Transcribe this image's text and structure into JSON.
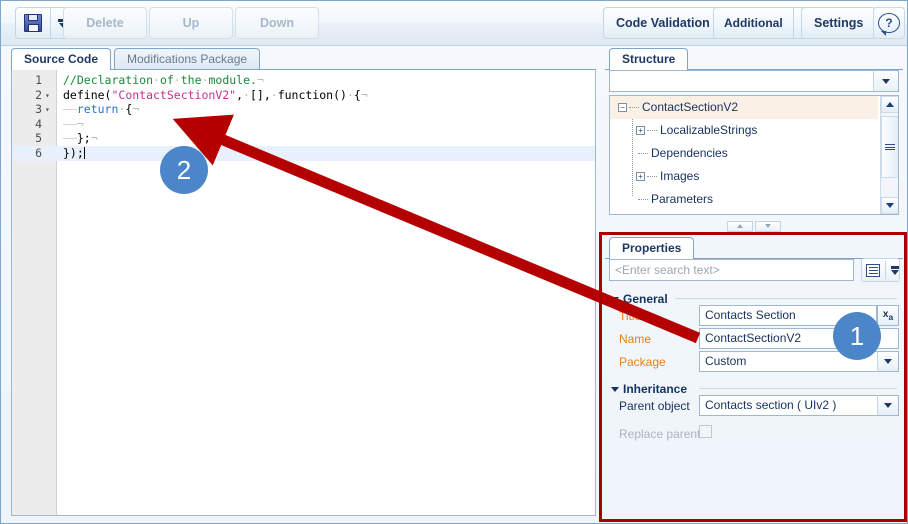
{
  "toolbar": {
    "save_icon": "floppy-save-icon",
    "save_dropdown_icon": "chevron-down-icon",
    "delete_label": "Delete",
    "up_label": "Up",
    "down_label": "Down",
    "code_validation_label": "Code Validation",
    "additional_label": "Additional",
    "additional_dropdown_icon": "chevron-down-icon",
    "settings_label": "Settings",
    "help_icon": "help-question-icon"
  },
  "editor": {
    "tabs": [
      {
        "label": "Source Code",
        "active": true
      },
      {
        "label": "Modifications Package",
        "active": false
      }
    ],
    "lines": [
      {
        "num": "1",
        "fold": "",
        "current": false,
        "tokens": [
          {
            "t": "comment",
            "v": "//Declaration"
          },
          {
            "t": "ws",
            "v": "·"
          },
          {
            "t": "comment",
            "v": "of"
          },
          {
            "t": "ws",
            "v": "·"
          },
          {
            "t": "comment",
            "v": "the"
          },
          {
            "t": "ws",
            "v": "·"
          },
          {
            "t": "comment",
            "v": "module."
          },
          {
            "t": "eol",
            "v": "¬"
          }
        ]
      },
      {
        "num": "2",
        "fold": "▾",
        "current": false,
        "tokens": [
          {
            "t": "plain",
            "v": "define("
          },
          {
            "t": "string",
            "v": "\"ContactSectionV2\""
          },
          {
            "t": "plain",
            "v": ","
          },
          {
            "t": "ws",
            "v": "·"
          },
          {
            "t": "plain",
            "v": "[],"
          },
          {
            "t": "ws",
            "v": "·"
          },
          {
            "t": "plain",
            "v": "function()"
          },
          {
            "t": "ws",
            "v": "·"
          },
          {
            "t": "plain",
            "v": "{"
          },
          {
            "t": "eol",
            "v": "¬"
          }
        ]
      },
      {
        "num": "3",
        "fold": "▾",
        "current": false,
        "tokens": [
          {
            "t": "indent",
            "v": "——"
          },
          {
            "t": "keyword",
            "v": "return"
          },
          {
            "t": "ws",
            "v": "·"
          },
          {
            "t": "plain",
            "v": "{"
          },
          {
            "t": "eol",
            "v": "¬"
          }
        ]
      },
      {
        "num": "4",
        "fold": "",
        "current": false,
        "tokens": [
          {
            "t": "indent",
            "v": "——"
          },
          {
            "t": "eol",
            "v": "¬"
          }
        ]
      },
      {
        "num": "5",
        "fold": "",
        "current": false,
        "tokens": [
          {
            "t": "indent",
            "v": "——"
          },
          {
            "t": "plain",
            "v": "};"
          },
          {
            "t": "eol",
            "v": "¬"
          }
        ]
      },
      {
        "num": "6",
        "fold": "",
        "current": true,
        "tokens": [
          {
            "t": "plain",
            "v": "});"
          },
          {
            "t": "caret",
            "v": ""
          }
        ]
      }
    ]
  },
  "structure": {
    "tab_label": "Structure",
    "combo_value": "",
    "combo_icon": "chevron-down-icon",
    "tree": [
      {
        "label": "ContactSectionV2",
        "depth": 0,
        "expander": "minus",
        "selected": true
      },
      {
        "label": "LocalizableStrings",
        "depth": 1,
        "expander": "plus",
        "selected": false
      },
      {
        "label": "Dependencies",
        "depth": 1,
        "expander": "none",
        "selected": false
      },
      {
        "label": "Images",
        "depth": 1,
        "expander": "plus",
        "selected": false
      },
      {
        "label": "Parameters",
        "depth": 1,
        "expander": "none",
        "selected": false
      }
    ],
    "scroll_up_icon": "triangle-up-icon",
    "scroll_down_icon": "triangle-down-icon",
    "scroll_thumb_icon": "grip-icon"
  },
  "splitter": {
    "collapse_up_icon": "triangle-up-icon",
    "collapse_down_icon": "triangle-down-icon"
  },
  "properties": {
    "tab_label": "Properties",
    "search_placeholder": "<Enter search text>",
    "search_value": "",
    "search_button_icon": "property-list-icon",
    "search_button_dropdown_icon": "chevron-down-icon",
    "sections": [
      {
        "title": "General"
      },
      {
        "title": "Inheritance"
      }
    ],
    "fields": {
      "title_label": "Title",
      "title_value": "Contacts Section",
      "title_translate_icon": "translate-xa-icon",
      "name_label": "Name",
      "name_value": "ContactSectionV2",
      "package_label": "Package",
      "package_value": "Custom",
      "package_dropdown_icon": "chevron-down-icon",
      "parent_object_label": "Parent object",
      "parent_object_value": "Contacts section ( UIv2 )",
      "parent_object_dropdown_icon": "chevron-down-icon",
      "replace_parent_label": "Replace parent",
      "replace_parent_checked": false
    }
  },
  "annotations": {
    "badge_one": "1",
    "badge_two": "2",
    "arrow_icon": "red-arrow-icon",
    "highlight_box_icon": "red-highlight-box",
    "accent_color": "#4a86c8",
    "highlight_color": "#a80000"
  }
}
